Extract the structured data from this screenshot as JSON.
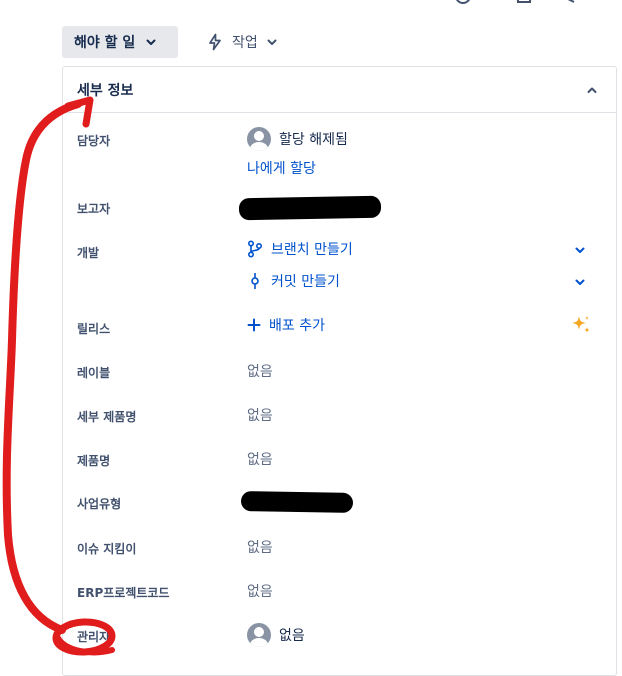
{
  "toolbar": {
    "status_button_label": "해야 할 일",
    "action_button_label": "작업"
  },
  "details_panel": {
    "title": "세부 정보",
    "fields": {
      "assignee": {
        "label": "담당자",
        "value": "할당 해제됨",
        "assign_to_me": "나에게 할당"
      },
      "reporter": {
        "label": "보고자"
      },
      "development": {
        "label": "개발",
        "create_branch": "브랜치 만들기",
        "create_commit": "커밋 만들기"
      },
      "release": {
        "label": "릴리스",
        "add_deployment": "배포 추가"
      },
      "labels": {
        "label": "레이블",
        "value": "없음"
      },
      "sub_product": {
        "label": "세부 제품명",
        "value": "없음"
      },
      "product": {
        "label": "제품명",
        "value": "없음"
      },
      "business_type": {
        "label": "사업유형"
      },
      "issue_points": {
        "label": "이슈 지킴이",
        "value": "없음"
      },
      "erp_project_code": {
        "label": "ERP프로젝트코드",
        "value": "없음"
      },
      "manager": {
        "label": "관리자",
        "value": "없음"
      }
    }
  },
  "colors": {
    "link": "#0052cc",
    "muted": "#5e6c84",
    "sparkle": "#f5a623",
    "annotation_red": "#e01c1c"
  }
}
